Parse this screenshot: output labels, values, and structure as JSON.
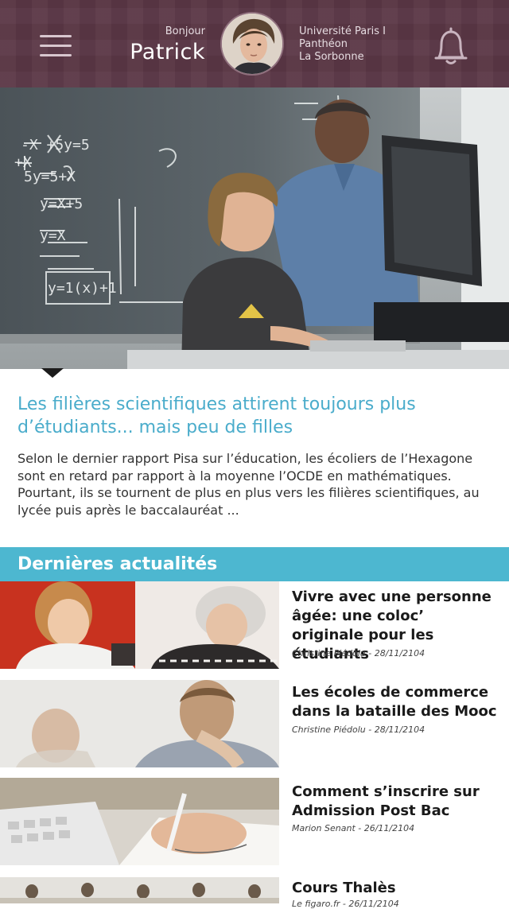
{
  "header": {
    "greeting": "Bonjour",
    "user_name": "Patrick",
    "university_line1": "Université Paris I",
    "university_line2": "Panthéon",
    "university_line3": "La Sorbonne",
    "menu_icon": "hamburger-menu-icon",
    "bell_icon": "bell-icon"
  },
  "featured": {
    "title": "Les filières scientifiques attirent toujours plus d’étudiants... mais peu de filles",
    "body": "Selon le dernier rapport Pisa sur l’éducation, les écoliers de l’Hexagone sont en retard par rapport à la moyenne l’OCDE en mathématiques. Pourtant, ils se tournent de plus en plus vers les filières scientifiques, au lycée puis après le baccalauréat ...",
    "chalkboard": [
      "-X +5y=5",
      "+X",
      "5y=5+X",
      "y=X+5",
      "y=X",
      "y=1(x)+1"
    ]
  },
  "section": {
    "title": "Dernières actualités"
  },
  "news": [
    {
      "title": "Vivre avec une personne âgée: une coloc’ originale pour les étudiants",
      "meta": "Christine Piédolu - 28/11/2104"
    },
    {
      "title": "Les écoles de commerce dans la bataille des Mooc",
      "meta": "Christine Piédolu - 28/11/2104"
    },
    {
      "title": "Comment s’inscrire sur Admission Post Bac",
      "meta": "Marion Senant - 26/11/2104"
    },
    {
      "title": "Cours Thalès",
      "meta": "Le figaro.fr - 26/11/2104"
    }
  ],
  "colors": {
    "header_bg": "#5b3746",
    "accent_blue": "#4aaccb",
    "section_bar": "#4db7d0"
  }
}
